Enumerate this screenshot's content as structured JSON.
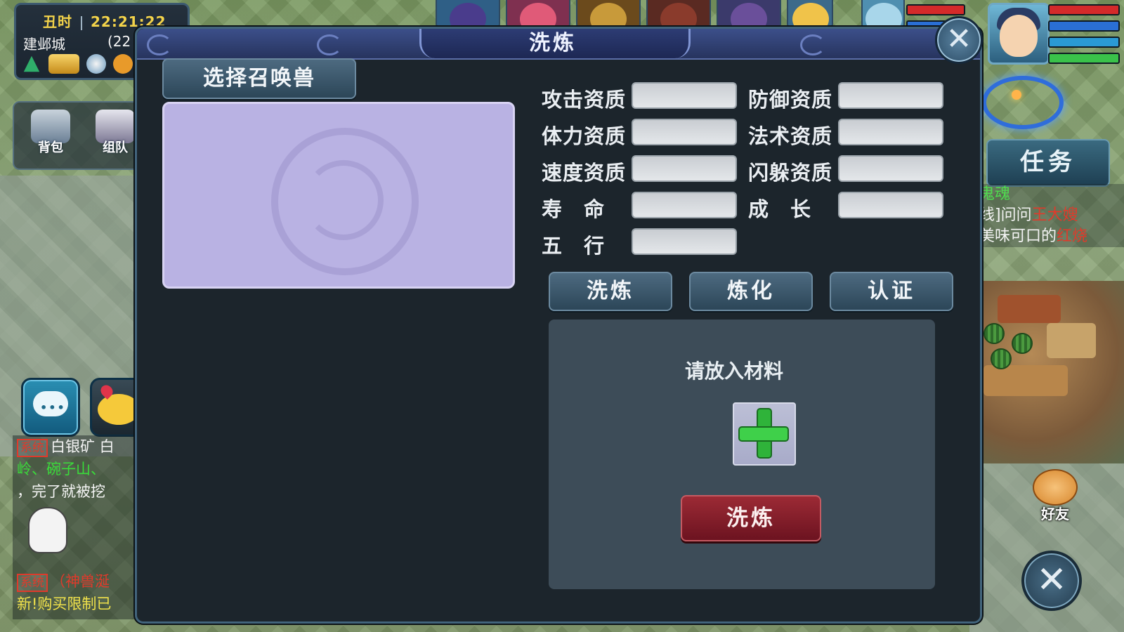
{
  "hud": {
    "shichen": "丑时",
    "clock": "22:21:22",
    "location": "建邺城",
    "coords": "(22",
    "bag_label": "背包",
    "team_label": "组队"
  },
  "chat_log": {
    "sys_tag": "系统",
    "line1": "白银矿 白",
    "line2": "岭、碗子山、",
    "line3": "，完了就被挖",
    "line4": "（神兽涎",
    "line5": "新!购买限制已"
  },
  "right_hud": {
    "task_label": "任务",
    "task_line1": "鬼魂",
    "task_line2_a": "线]问问",
    "task_line2_b": "王大嫂",
    "task_line3_a": "美味可口的",
    "task_line3_b": "红烧",
    "friend_label": "好友"
  },
  "dialog": {
    "title": "洗炼",
    "close_glyph": "✕",
    "select_pet_label": "选择召唤兽",
    "attributes": {
      "attack": "攻击资质",
      "defense": "防御资质",
      "stamina": "体力资质",
      "magic": "法术资质",
      "speed": "速度资质",
      "dodge": "闪躲资质",
      "lifespan": "寿　命",
      "growth": "成　长",
      "element": "五　行"
    },
    "tabs": {
      "wash": "洗炼",
      "refine": "炼化",
      "certify": "认证"
    },
    "material_hint": "请放入材料",
    "wash_button": "洗炼"
  },
  "colors": {
    "accent_red": "#e03a2b",
    "chat_green": "#3adc3a",
    "chat_yellow": "#f1e24b",
    "task_green": "#4fdc4f"
  }
}
